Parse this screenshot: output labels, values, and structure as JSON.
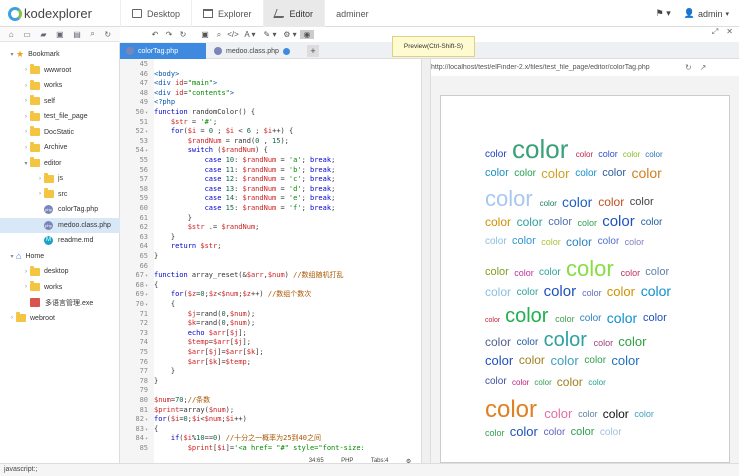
{
  "app": {
    "name": "kodexplorer"
  },
  "nav": {
    "tabs": [
      {
        "label": "Desktop"
      },
      {
        "label": "Explorer"
      },
      {
        "label": "Editor"
      },
      {
        "label": "adminer"
      }
    ],
    "user": "admin"
  },
  "tooltip": "Preview(Ctrl-Shift-S)",
  "tree": [
    {
      "label": "Bookmark",
      "type": "star",
      "depth": 0,
      "open": true
    },
    {
      "label": "wwwroot",
      "type": "folder",
      "depth": 1
    },
    {
      "label": "works",
      "type": "folder",
      "depth": 1
    },
    {
      "label": "self",
      "type": "folder",
      "depth": 1
    },
    {
      "label": "test_file_page",
      "type": "folder",
      "depth": 1
    },
    {
      "label": "DocStatic",
      "type": "folder",
      "depth": 1
    },
    {
      "label": "Archive",
      "type": "folder",
      "depth": 1
    },
    {
      "label": "editor",
      "type": "folder",
      "depth": 1,
      "open": true
    },
    {
      "label": "js",
      "type": "folder",
      "depth": 2
    },
    {
      "label": "src",
      "type": "folder",
      "depth": 2
    },
    {
      "label": "colorTag.php",
      "type": "php",
      "depth": 2
    },
    {
      "label": "medoo.class.php",
      "type": "php",
      "depth": 2,
      "selected": true
    },
    {
      "label": "readme.md",
      "type": "md",
      "depth": 2
    },
    {
      "label": "Home",
      "type": "home",
      "depth": 0,
      "open": true
    },
    {
      "label": "desktop",
      "type": "folder",
      "depth": 1
    },
    {
      "label": "works",
      "type": "folder",
      "depth": 1
    },
    {
      "label": "多语言管理.exe",
      "type": "exe",
      "depth": 1
    },
    {
      "label": "webroot",
      "type": "folder",
      "depth": 0
    }
  ],
  "editor_tabs": [
    {
      "label": "colorTag.php",
      "active": true
    },
    {
      "label": "medoo.class.php",
      "active": false
    }
  ],
  "code": [
    {
      "n": "45",
      "html": ""
    },
    {
      "n": "46",
      "html": "<span class='tag'>&lt;body&gt;</span>"
    },
    {
      "n": "47",
      "html": "<span class='tag'>&lt;div</span> <span class='var'>id</span>=<span class='str'>\"main\"</span><span class='tag'>&gt;</span>"
    },
    {
      "n": "48",
      "html": "<span class='tag'>&lt;div</span> <span class='var'>id</span>=<span class='str'>\"contents\"</span><span class='tag'>&gt;</span>"
    },
    {
      "n": "49",
      "html": "<span class='tag'>&lt;?php</span>"
    },
    {
      "n": "50",
      "html": "<span class='kw'>function</span> randomColor() {"
    },
    {
      "n": "51",
      "html": "    <span class='var'>$str</span> = <span class='str'>'#'</span>;"
    },
    {
      "n": "52",
      "html": "    <span class='kw'>for</span>(<span class='var'>$i</span> = <span class='num'>0</span> ; <span class='var'>$i</span> &lt; <span class='num'>6</span> ; <span class='var'>$i</span>++) {"
    },
    {
      "n": "53",
      "html": "        <span class='var'>$randNum</span> = rand(<span class='num'>0</span> , <span class='num'>15</span>);"
    },
    {
      "n": "54",
      "html": "        <span class='kw'>switch</span> (<span class='var'>$randNum</span>) {"
    },
    {
      "n": "55",
      "html": "            <span class='kw'>case</span> <span class='num'>10</span>: <span class='var'>$randNum</span> = <span class='str'>'a'</span>; <span class='kw'>break</span>;"
    },
    {
      "n": "56",
      "html": "            <span class='kw'>case</span> <span class='num'>11</span>: <span class='var'>$randNum</span> = <span class='str'>'b'</span>; <span class='kw'>break</span>;"
    },
    {
      "n": "57",
      "html": "            <span class='kw'>case</span> <span class='num'>12</span>: <span class='var'>$randNum</span> = <span class='str'>'c'</span>; <span class='kw'>break</span>;"
    },
    {
      "n": "58",
      "html": "            <span class='kw'>case</span> <span class='num'>13</span>: <span class='var'>$randNum</span> = <span class='str'>'d'</span>; <span class='kw'>break</span>;"
    },
    {
      "n": "59",
      "html": "            <span class='kw'>case</span> <span class='num'>14</span>: <span class='var'>$randNum</span> = <span class='str'>'e'</span>; <span class='kw'>break</span>;"
    },
    {
      "n": "60",
      "html": "            <span class='kw'>case</span> <span class='num'>15</span>: <span class='var'>$randNum</span> = <span class='str'>'f'</span>; <span class='kw'>break</span>;"
    },
    {
      "n": "61",
      "html": "        }"
    },
    {
      "n": "62",
      "html": "        <span class='var'>$str</span> .= <span class='var'>$randNum</span>;"
    },
    {
      "n": "63",
      "html": "    }"
    },
    {
      "n": "64",
      "html": "    <span class='kw'>return</span> <span class='var'>$str</span>;"
    },
    {
      "n": "65",
      "html": "}"
    },
    {
      "n": "66",
      "html": ""
    },
    {
      "n": "67",
      "html": "<span class='kw'>function</span> array_reset(&amp;<span class='var'>$arr</span>,<span class='var'>$num</span>) <span class='cm'>//数组随机打乱</span>"
    },
    {
      "n": "68",
      "html": "{"
    },
    {
      "n": "69",
      "html": "    <span class='kw'>for</span>(<span class='var'>$z</span>=<span class='num'>0</span>;<span class='var'>$z</span>&lt;<span class='var'>$num</span>;<span class='var'>$z</span>++) <span class='cm'>//数组个数次</span>"
    },
    {
      "n": "70",
      "html": "    {"
    },
    {
      "n": "71",
      "html": "        <span class='var'>$j</span>=rand(<span class='num'>0</span>,<span class='var'>$num</span>);"
    },
    {
      "n": "72",
      "html": "        <span class='var'>$k</span>=rand(<span class='num'>0</span>,<span class='var'>$num</span>);"
    },
    {
      "n": "73",
      "html": "        <span class='kw'>echo</span> <span class='var'>$arr</span>[<span class='var'>$j</span>];"
    },
    {
      "n": "74",
      "html": "        <span class='var'>$temp</span>=<span class='var'>$arr</span>[<span class='var'>$j</span>];"
    },
    {
      "n": "75",
      "html": "        <span class='var'>$arr</span>[<span class='var'>$j</span>]=<span class='var'>$arr</span>[<span class='var'>$k</span>];"
    },
    {
      "n": "76",
      "html": "        <span class='var'>$arr</span>[<span class='var'>$k</span>]=<span class='var'>$temp</span>;"
    },
    {
      "n": "77",
      "html": "    }"
    },
    {
      "n": "78",
      "html": "}"
    },
    {
      "n": "79",
      "html": ""
    },
    {
      "n": "80",
      "html": "<span class='var'>$num</span>=<span class='num'>70</span>;<span class='cm'>//条数</span>"
    },
    {
      "n": "81",
      "html": "<span class='var'>$print</span>=array(<span class='var'>$num</span>);"
    },
    {
      "n": "82",
      "html": "<span class='kw'>for</span>(<span class='var'>$i</span>=<span class='num'>0</span>;<span class='var'>$i</span>&lt;<span class='var'>$num</span>;<span class='var'>$i</span>++)"
    },
    {
      "n": "83",
      "html": "{"
    },
    {
      "n": "84",
      "html": "    <span class='kw'>if</span>(<span class='var'>$i</span>%<span class='num'>10</span>==<span class='num'>0</span>) <span class='cm'>//十分之一概率为25到40之间</span>"
    },
    {
      "n": "85",
      "html": "        <span class='var'>$print</span>[<span class='var'>$i</span>]=<span class='str'>'&lt;a href= \"#\" style=\"font-size:</span>"
    }
  ],
  "status": {
    "pos": "34:65",
    "mode": "PHP",
    "tabs": "Tabs:4"
  },
  "preview_url": "http://localhost/test/elFinder-2.x/files/test_file_page/editor/colorTag.php",
  "preview_word": "color",
  "bottom_text": "javascript:;"
}
